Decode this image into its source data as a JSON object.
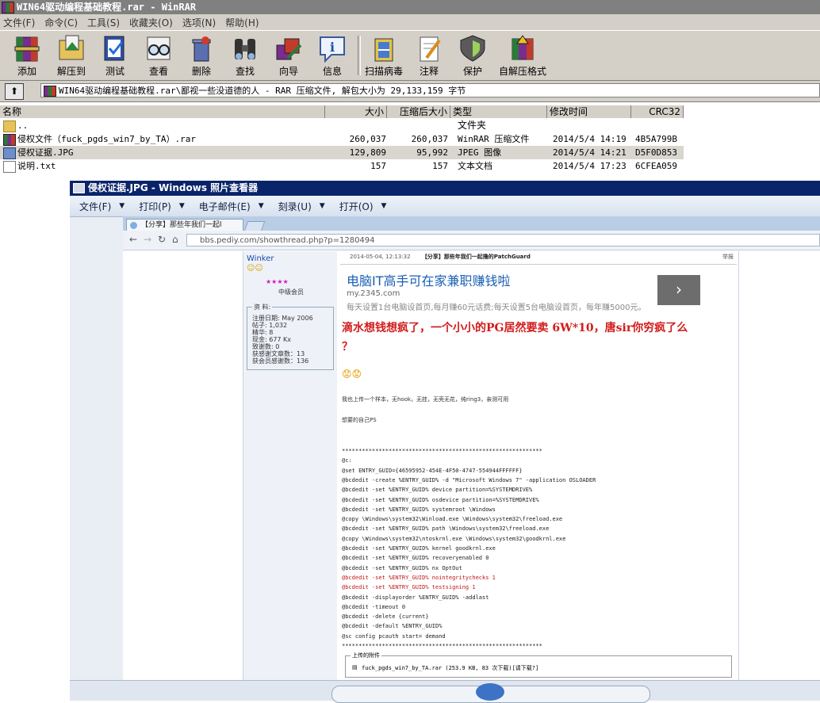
{
  "rar": {
    "title": "WIN64驱动编程基础教程.rar - WinRAR",
    "menu": [
      "文件(F)",
      "命令(C)",
      "工具(S)",
      "收藏夹(O)",
      "选项(N)",
      "帮助(H)"
    ],
    "toolbar": [
      "添加",
      "解压到",
      "测试",
      "查看",
      "删除",
      "查找",
      "向导",
      "信息",
      "扫描病毒",
      "注释",
      "保护",
      "自解压格式"
    ],
    "address": "WIN64驱动编程基础教程.rar\\鄙视一些没道德的人 - RAR 压缩文件, 解包大小为 29,133,159 字节",
    "columns": {
      "name": "名称",
      "size": "大小",
      "packed": "压缩后大小",
      "type": "类型",
      "modified": "修改时间",
      "crc": "CRC32"
    },
    "files": [
      {
        "name": "..",
        "size": "",
        "packed": "",
        "type": "文件夹",
        "modified": "",
        "crc": "",
        "icon": "folder-up-icon"
      },
      {
        "name": "侵权文件（fuck_pgds_win7_by_TA）.rar",
        "size": "260,037",
        "packed": "260,037",
        "type": "WinRAR 压缩文件",
        "modified": "2014/5/4 14:19",
        "crc": "4B5A799B",
        "icon": "rar-file-icon"
      },
      {
        "name": "侵权证据.JPG",
        "size": "129,809",
        "packed": "95,992",
        "type": "JPEG 图像",
        "modified": "2014/5/4 14:21",
        "crc": "D5F0D853",
        "icon": "image-file-icon"
      },
      {
        "name": "说明.txt",
        "size": "157",
        "packed": "157",
        "type": "文本文档",
        "modified": "2014/5/4 17:23",
        "crc": "6CFEA059",
        "icon": "text-file-icon"
      }
    ]
  },
  "viewer": {
    "title": "侵权证据.JPG - Windows 照片查看器",
    "menu": [
      "文件(F)",
      "打印(P)",
      "电子邮件(E)",
      "刻录(U)",
      "打开(O)"
    ]
  },
  "photo": {
    "tab": "【分享】那些年我们一起l",
    "url": "bbs.pediy.com/showthread.php?p=1280494",
    "user": "Winker",
    "rank": "中级会员",
    "profile_title": "资 料:",
    "profile": [
      "注册日期: May 2006",
      "帖子: 1,032",
      "精华: 8",
      "现金: 677 Kx",
      "致谢数: 0",
      "获感谢文章数：13",
      "获会员感谢数：136"
    ],
    "post_meta": "2014-05-04, 12:13:32",
    "post_title": "【分享】那些年我们一起撸的PatchGuard",
    "report": "举报",
    "ad_title": "电脑IT高手可在家兼职赚钱啦",
    "ad_domain": "my.2345.com",
    "ad_desc": "每天设置1台电脑设首页,每月赚60元话费;每天设置5台电脑设首页，每年赚5000元。",
    "headline": "滴水想钱想疯了，一个小小的PG居然要卖 6W*10，唐sir你穷疯了么",
    "headline_end": "？",
    "line1": "我也上传一个样本，无hook，无挂，无壳无花，纯ring3，亲测可用",
    "line2": "想要的自己PS",
    "code": [
      {
        "t": "************************************************************",
        "red": false
      },
      {
        "t": "@c:",
        "red": false
      },
      {
        "t": "@set ENTRY_GUID={46595952-454E-4F50-4747-554944FFFFFF}",
        "red": false
      },
      {
        "t": "@bcdedit -create %ENTRY_GUID% -d \"Microsoft Windows 7\" -application OSLOADER",
        "red": false
      },
      {
        "t": "@bcdedit -set %ENTRY_GUID% device partition=%SYSTEMDRIVE%",
        "red": false
      },
      {
        "t": "@bcdedit -set %ENTRY_GUID% osdevice partition=%SYSTEMDRIVE%",
        "red": false
      },
      {
        "t": "@bcdedit -set %ENTRY_GUID% systemroot \\Windows",
        "red": false
      },
      {
        "t": "@copy \\Windows\\system32\\Winload.exe \\Windows\\system32\\freeload.exe",
        "red": false
      },
      {
        "t": "@bcdedit -set %ENTRY_GUID% path \\Windows\\system32\\freeload.exe",
        "red": false
      },
      {
        "t": "@copy \\Windows\\system32\\ntoskrnl.exe \\Windows\\system32\\goodkrnl.exe",
        "red": false
      },
      {
        "t": "@bcdedit -set %ENTRY_GUID% kernel goodkrnl.exe",
        "red": false
      },
      {
        "t": "@bcdedit -set %ENTRY_GUID% recoveryenabled 0",
        "red": false
      },
      {
        "t": "@bcdedit -set %ENTRY_GUID% nx OptOut",
        "red": false
      },
      {
        "t": "@bcdedit -set %ENTRY_GUID% nointegritychecks 1",
        "red": true
      },
      {
        "t": "@bcdedit -set %ENTRY_GUID% testsigning 1",
        "red": true
      },
      {
        "t": "@bcdedit -displayorder %ENTRY_GUID% -addlast",
        "red": false
      },
      {
        "t": "@bcdedit -timeout 0",
        "red": false
      },
      {
        "t": "@bcdedit -delete {current}",
        "red": false
      },
      {
        "t": "@bcdedit -default %ENTRY_GUID%",
        "red": false
      },
      {
        "t": "@sc config pcauth start= demand",
        "red": false
      },
      {
        "t": "************************************************************",
        "red": false
      }
    ],
    "attach_label": "上传的附件",
    "attach_file": "fuck_pgds_win7_by_TA.rar (253.9 KB, 83 次下载)[请下载?]"
  },
  "colors": {
    "rar_gray": "#d4d0c8",
    "viewer_title": "#0a246a",
    "ad_blue": "#1a5fb4",
    "headline_red": "#d21c1c"
  }
}
